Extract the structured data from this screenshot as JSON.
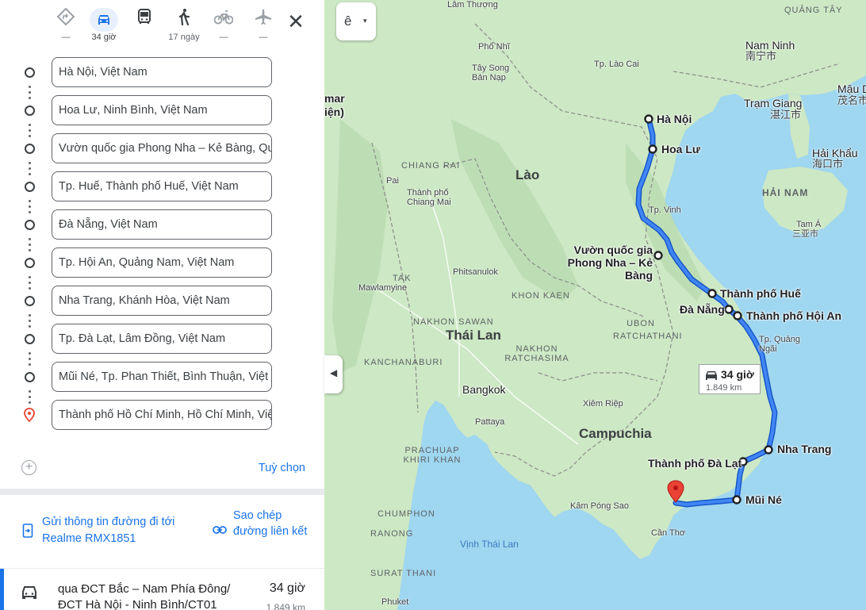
{
  "panel": {
    "modes": [
      {
        "name": "best-mode",
        "icon": "diamond-turn-icon",
        "label": "—"
      },
      {
        "name": "car-mode",
        "icon": "car-icon",
        "label": "34 giờ"
      },
      {
        "name": "transit-mode",
        "icon": "bus-icon",
        "label": ""
      },
      {
        "name": "walk-mode",
        "icon": "walk-icon",
        "label": "17 ngày"
      },
      {
        "name": "bike-mode",
        "icon": "bike-icon",
        "label": "—"
      },
      {
        "name": "flight-mode",
        "icon": "plane-icon",
        "label": "—"
      }
    ],
    "stops": [
      "Hà Nội, Việt Nam",
      "Hoa Lư, Ninh Bình, Việt Nam",
      "Vườn quốc gia Phong Nha – Kẻ Bàng, Qu",
      "Tp. Huế, Thành phố Huế, Việt Nam",
      "Đà Nẵng, Việt Nam",
      "Tp. Hội An, Quảng Nam, Việt Nam",
      "Nha Trang, Khánh Hòa, Việt Nam",
      "Tp. Đà Lạt, Lâm Đồng, Việt Nam",
      "Mũi Né, Tp. Phan Thiết, Bình Thuận, Việt N",
      "Thành phố Hồ Chí Minh, Hồ Chí Minh, Việ"
    ],
    "options_label": "Tuỳ chọn",
    "send_label": "Gửi thông tin đường đi tới Realme RMX1851",
    "copy_label": "Sao chép đường liên kết",
    "route": {
      "via": "qua ĐCT Bắc – Nam Phía Đông/ ĐCT Hà Nội - Ninh Bình/CT01",
      "time": "34 giờ",
      "distance": "1.849 km"
    }
  },
  "map": {
    "layer_button_label": "ê",
    "duration_box": {
      "time": "34 giờ",
      "distance": "1.849 km"
    },
    "countries": {
      "laos": "Lào",
      "thailand": "Thái Lan",
      "cambodia": "Campuchia"
    },
    "route_cities": {
      "hanoi": "Hà Nội",
      "hoalu": "Hoa Lư",
      "phongnha": "Vườn quốc gia Phong Nha – Kẻ Bàng",
      "hue": "Thành phố Huế",
      "danang": "Đà Nẵng",
      "hoian": "Thành phố Hội An",
      "nhatrang": "Nha Trang",
      "dalat": "Thành phố Đà Lạt",
      "muine": "Mũi Né"
    },
    "places": {
      "lamthuong": "Lâm Thượng",
      "phongsaly": "Phổ Nhĩ",
      "taysong": "Tây Song Bản Nạp",
      "laocai": "Tp. Lào Cai",
      "quangtay": "QUẢNG TÂY",
      "namninh": "Nam Ninh",
      "namninh_cn": "南宁市",
      "tramgiang": "Trạm Giang",
      "tramgiang_cn": "湛江市",
      "mauda": "Mậu D",
      "mauda_cn": "茂名市",
      "haikhau": "Hải Khẩu",
      "haikhau_cn": "海口市",
      "hainam": "HẢI NAM",
      "tama": "Tam Á",
      "tama_cn": "三亚市",
      "chiangrai": "CHIANG RAI",
      "pai": "Pai",
      "chiangmai": "Thành phố Chiang Mai",
      "tpvinh": "Tp. Vinh",
      "tak": "TAK",
      "mawlamyine": "Mawlamyine",
      "phitsanulok": "Phitsanulok",
      "khonkaen": "KHON KAEN",
      "nakhonsawan": "NAKHON SAWAN",
      "ubon": "UBON RATCHATHANI",
      "nakhonratchasima": "NAKHON RATCHASIMA",
      "tpquangngai": "Tp. Quảng Ngãi",
      "kanchanaburi": "KANCHANABURI",
      "bangkok": "Bangkok",
      "xiemriep": "Xiêm Riệp",
      "pattaya": "Pattaya",
      "prachuap": "PRACHUAP KHIRI KHAN",
      "kampongsao": "Kâm Póng Sao",
      "chumphon": "CHUMPHON",
      "ranong": "RANONG",
      "vinhthailan": "Vịnh Thái Lan",
      "cantho": "Cần Thơ",
      "suratthani": "SURAT THANI",
      "phuket": "Phuket",
      "mar": "mar",
      "dien": "iện)"
    }
  },
  "colors": {
    "route": "#1a73e8",
    "land": "#cde8c4",
    "sea": "#9fd6f0",
    "pin": "#ea4335"
  }
}
